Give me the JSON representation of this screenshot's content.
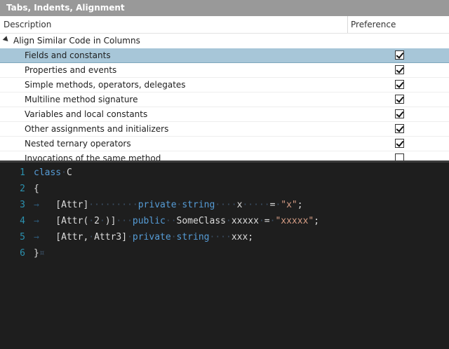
{
  "window": {
    "title": "Tabs, Indents, Alignment"
  },
  "grid": {
    "columns": [
      "Description",
      "Preference"
    ],
    "group": {
      "label": "Align Similar Code in Columns",
      "expanded": true
    },
    "rows": [
      {
        "label": "Fields and constants",
        "checked": true,
        "selected": true
      },
      {
        "label": "Properties and events",
        "checked": true
      },
      {
        "label": "Simple methods, operators, delegates",
        "checked": true
      },
      {
        "label": "Multiline method signature",
        "checked": true
      },
      {
        "label": "Variables and local constants",
        "checked": true
      },
      {
        "label": "Other assignments and initializers",
        "checked": true
      },
      {
        "label": "Nested ternary operators",
        "checked": true
      },
      {
        "label": "Invocations of the same method",
        "checked": false
      }
    ]
  },
  "editor": {
    "lines": [
      {
        "num": "1",
        "text": "class C"
      },
      {
        "num": "2",
        "text": "{"
      },
      {
        "num": "3",
        "text": "[Attr] private string x = \"x\";"
      },
      {
        "num": "4",
        "text": "[Attr( 2 )] public SomeClass xxxxx = \"xxxxx\";"
      },
      {
        "num": "5",
        "text": "[Attr, Attr3] private string xxx;"
      },
      {
        "num": "6",
        "text": "}"
      }
    ],
    "colors": {
      "keyword": "#569cd6",
      "string": "#d69d85",
      "line_number": "#2b91af",
      "whitespace_marker": "#3a4e63"
    }
  },
  "icons": {
    "tree_toggle": "triangle-expanded-icon",
    "checkbox": "checkmark-icon",
    "tab_marker": "tab-arrow-icon",
    "whitespace_marker": "dot-icon"
  }
}
